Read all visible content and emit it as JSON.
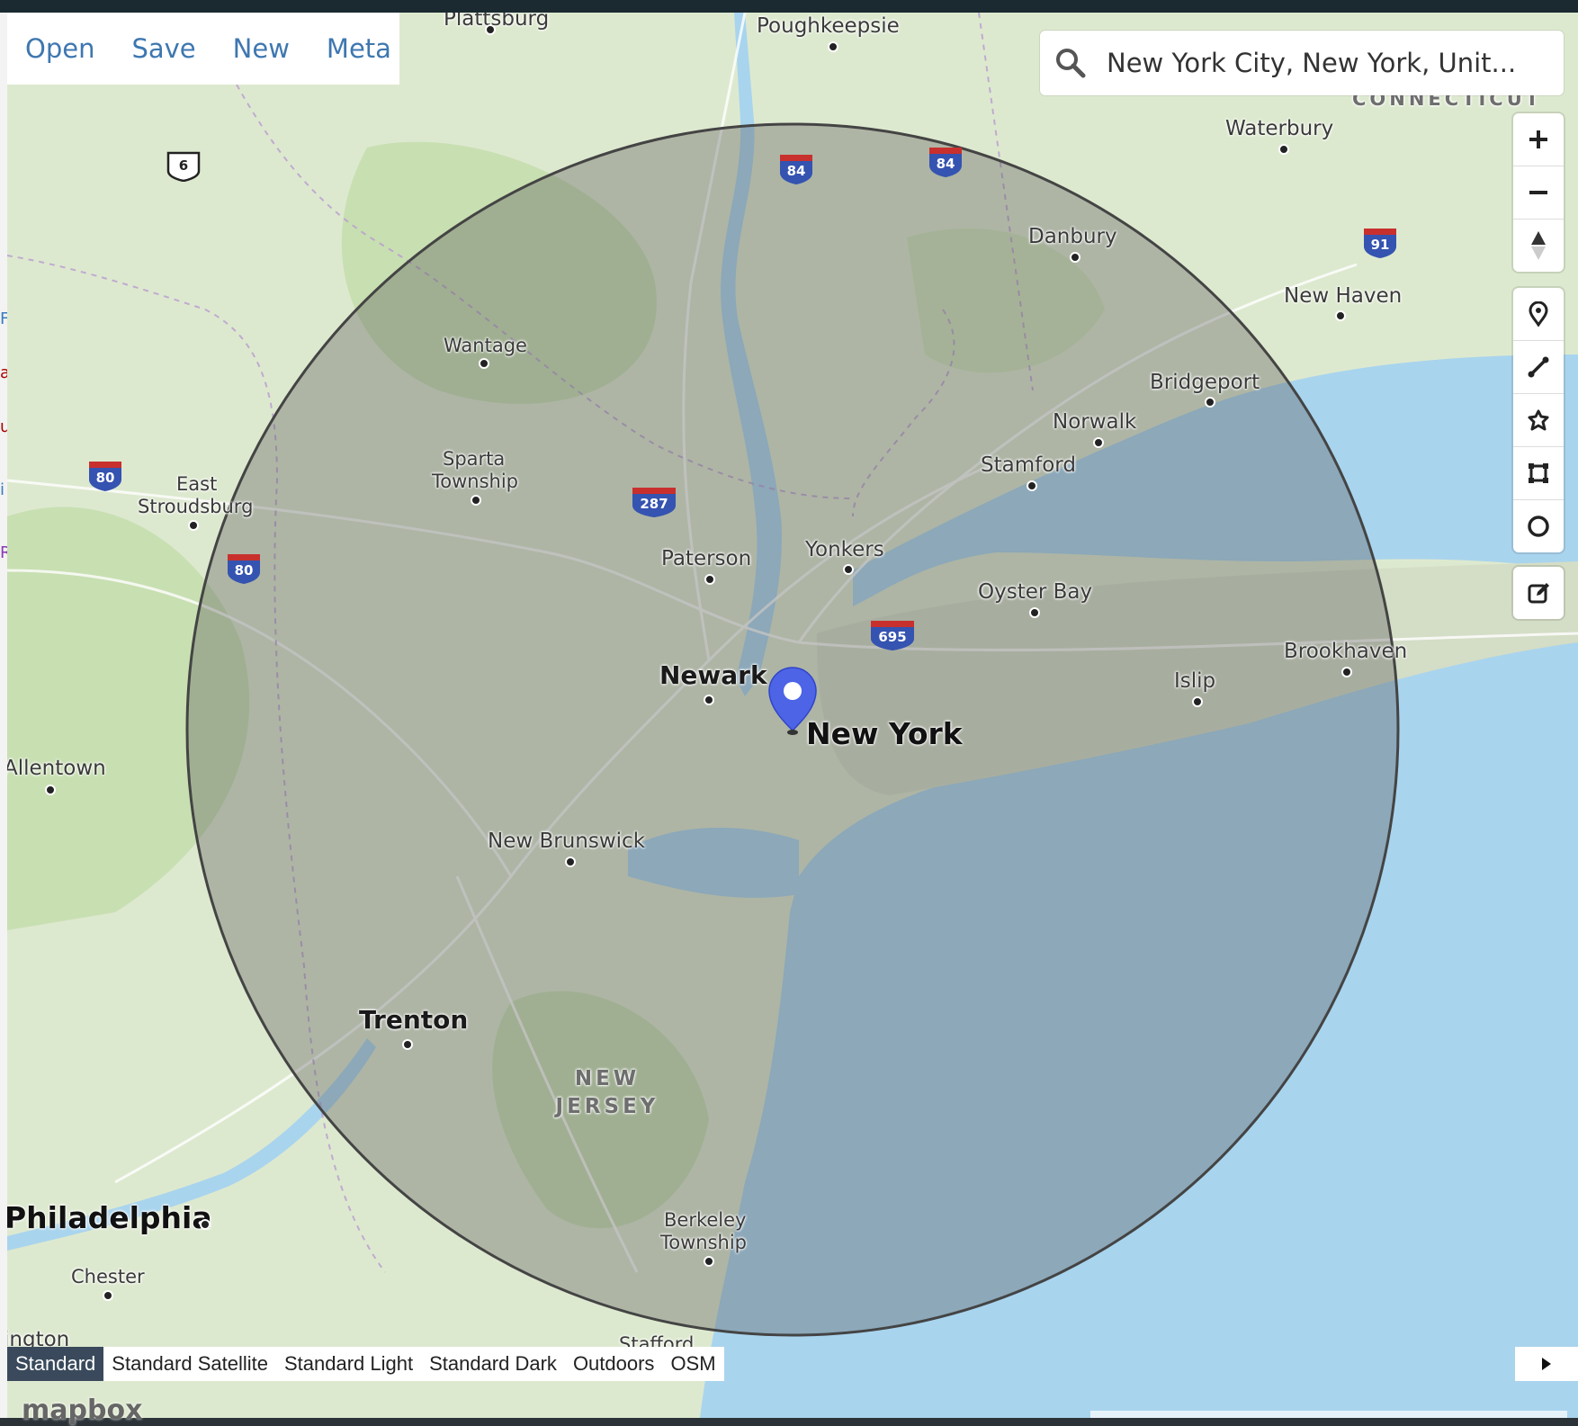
{
  "menu": {
    "open": "Open",
    "save": "Save",
    "new": "New",
    "meta": "Meta"
  },
  "search": {
    "value": "New York City, New York, Unit..."
  },
  "map_labels": {
    "poughkeepsie": "Poughkeepsie",
    "plattsburgh": "Plattsburg",
    "waterbury": "Waterbury",
    "connecticut": "CONNECTICUT",
    "danbury": "Danbury",
    "new_haven": "New Haven",
    "bridgeport": "Bridgeport",
    "norwalk": "Norwalk",
    "stamford": "Stamford",
    "wantage": "Wantage",
    "sparta_1": "Sparta",
    "sparta_2": "Township",
    "east_1": "East",
    "east_2": "Stroudsburg",
    "paterson": "Paterson",
    "yonkers": "Yonkers",
    "oyster_bay": "Oyster Bay",
    "brookhaven": "Brookhaven",
    "islip": "Islip",
    "newark": "Newark",
    "new_york": "New York",
    "allentown": "Allentown",
    "new_brunswick": "New Brunswick",
    "trenton": "Trenton",
    "new_jersey_1": "NEW",
    "new_jersey_2": "JERSEY",
    "berkeley_1": "Berkeley",
    "berkeley_2": "Township",
    "philadelphia": "Philadelphia",
    "chester": "Chester",
    "stafford": "Stafford",
    "wilmington": "ington"
  },
  "shields": {
    "us6": "6",
    "i84a": "84",
    "i84b": "84",
    "i91": "91",
    "i80a": "80",
    "i80b": "80",
    "i287": "287",
    "i695": "695"
  },
  "style_switcher": [
    "Standard",
    "Standard Satellite",
    "Standard Light",
    "Standard Dark",
    "Outdoors",
    "OSM"
  ],
  "active_style": "Standard",
  "logo": "mapbox",
  "colors": {
    "water": "#a9d4ee",
    "land": "#dde9cf",
    "circle_fill": "#555555",
    "marker": "#4d64e6",
    "link": "#3e77b0"
  }
}
